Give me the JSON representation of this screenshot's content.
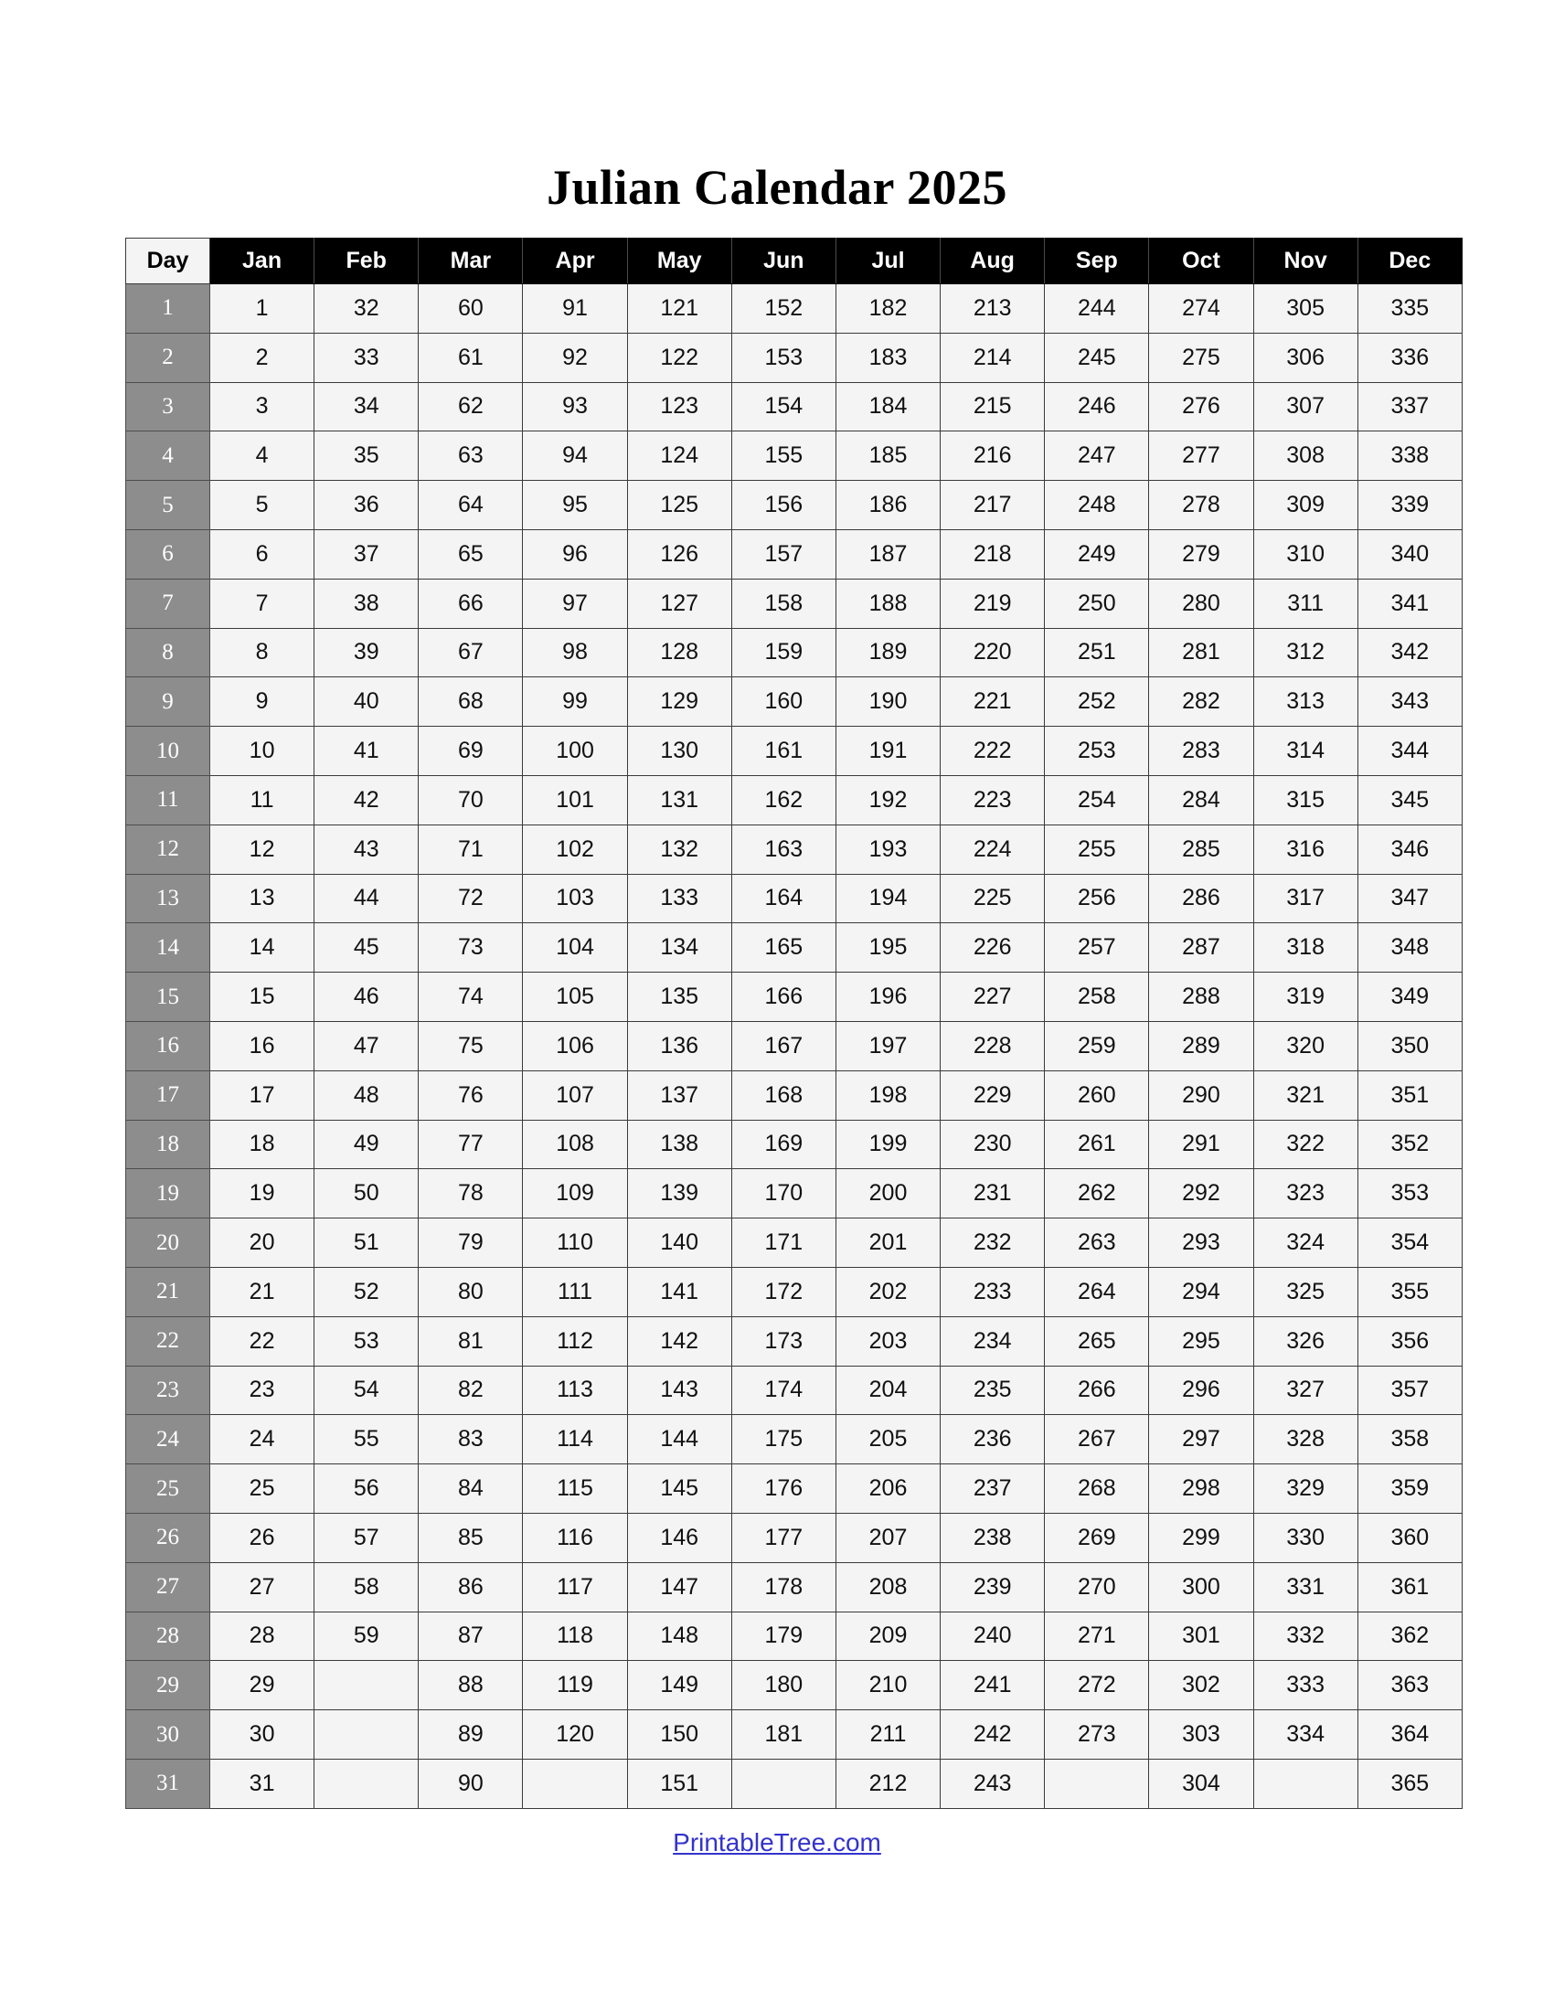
{
  "document": {
    "title": "Julian Calendar 2025",
    "year": "2025"
  },
  "footer": {
    "link_label": "PrintableTree.com",
    "link_color": "#3333cc"
  },
  "colors": {
    "header_background": "#000000",
    "header_text": "#ffffff",
    "day_header_background": "#f4f4f4",
    "day_header_text": "#000000",
    "day_column_background": "#8d8d8d",
    "day_column_text": "#ffffff",
    "cell_background": "#f4f4f4",
    "cell_text": "#111111",
    "border": "#3a3a3a",
    "page_background": "#ffffff"
  },
  "table": {
    "headers": [
      "Day",
      "Jan",
      "Feb",
      "Mar",
      "Apr",
      "May",
      "Jun",
      "Jul",
      "Aug",
      "Sep",
      "Oct",
      "Nov",
      "Dec"
    ],
    "day_header": "Day",
    "month_headers": [
      "Jan",
      "Feb",
      "Mar",
      "Apr",
      "May",
      "Jun",
      "Jul",
      "Aug",
      "Sep",
      "Oct",
      "Nov",
      "Dec"
    ],
    "rows": [
      {
        "day": "1",
        "values": [
          "1",
          "32",
          "60",
          "91",
          "121",
          "152",
          "182",
          "213",
          "244",
          "274",
          "305",
          "335"
        ]
      },
      {
        "day": "2",
        "values": [
          "2",
          "33",
          "61",
          "92",
          "122",
          "153",
          "183",
          "214",
          "245",
          "275",
          "306",
          "336"
        ]
      },
      {
        "day": "3",
        "values": [
          "3",
          "34",
          "62",
          "93",
          "123",
          "154",
          "184",
          "215",
          "246",
          "276",
          "307",
          "337"
        ]
      },
      {
        "day": "4",
        "values": [
          "4",
          "35",
          "63",
          "94",
          "124",
          "155",
          "185",
          "216",
          "247",
          "277",
          "308",
          "338"
        ]
      },
      {
        "day": "5",
        "values": [
          "5",
          "36",
          "64",
          "95",
          "125",
          "156",
          "186",
          "217",
          "248",
          "278",
          "309",
          "339"
        ]
      },
      {
        "day": "6",
        "values": [
          "6",
          "37",
          "65",
          "96",
          "126",
          "157",
          "187",
          "218",
          "249",
          "279",
          "310",
          "340"
        ]
      },
      {
        "day": "7",
        "values": [
          "7",
          "38",
          "66",
          "97",
          "127",
          "158",
          "188",
          "219",
          "250",
          "280",
          "311",
          "341"
        ]
      },
      {
        "day": "8",
        "values": [
          "8",
          "39",
          "67",
          "98",
          "128",
          "159",
          "189",
          "220",
          "251",
          "281",
          "312",
          "342"
        ]
      },
      {
        "day": "9",
        "values": [
          "9",
          "40",
          "68",
          "99",
          "129",
          "160",
          "190",
          "221",
          "252",
          "282",
          "313",
          "343"
        ]
      },
      {
        "day": "10",
        "values": [
          "10",
          "41",
          "69",
          "100",
          "130",
          "161",
          "191",
          "222",
          "253",
          "283",
          "314",
          "344"
        ]
      },
      {
        "day": "11",
        "values": [
          "11",
          "42",
          "70",
          "101",
          "131",
          "162",
          "192",
          "223",
          "254",
          "284",
          "315",
          "345"
        ]
      },
      {
        "day": "12",
        "values": [
          "12",
          "43",
          "71",
          "102",
          "132",
          "163",
          "193",
          "224",
          "255",
          "285",
          "316",
          "346"
        ]
      },
      {
        "day": "13",
        "values": [
          "13",
          "44",
          "72",
          "103",
          "133",
          "164",
          "194",
          "225",
          "256",
          "286",
          "317",
          "347"
        ]
      },
      {
        "day": "14",
        "values": [
          "14",
          "45",
          "73",
          "104",
          "134",
          "165",
          "195",
          "226",
          "257",
          "287",
          "318",
          "348"
        ]
      },
      {
        "day": "15",
        "values": [
          "15",
          "46",
          "74",
          "105",
          "135",
          "166",
          "196",
          "227",
          "258",
          "288",
          "319",
          "349"
        ]
      },
      {
        "day": "16",
        "values": [
          "16",
          "47",
          "75",
          "106",
          "136",
          "167",
          "197",
          "228",
          "259",
          "289",
          "320",
          "350"
        ]
      },
      {
        "day": "17",
        "values": [
          "17",
          "48",
          "76",
          "107",
          "137",
          "168",
          "198",
          "229",
          "260",
          "290",
          "321",
          "351"
        ]
      },
      {
        "day": "18",
        "values": [
          "18",
          "49",
          "77",
          "108",
          "138",
          "169",
          "199",
          "230",
          "261",
          "291",
          "322",
          "352"
        ]
      },
      {
        "day": "19",
        "values": [
          "19",
          "50",
          "78",
          "109",
          "139",
          "170",
          "200",
          "231",
          "262",
          "292",
          "323",
          "353"
        ]
      },
      {
        "day": "20",
        "values": [
          "20",
          "51",
          "79",
          "110",
          "140",
          "171",
          "201",
          "232",
          "263",
          "293",
          "324",
          "354"
        ]
      },
      {
        "day": "21",
        "values": [
          "21",
          "52",
          "80",
          "111",
          "141",
          "172",
          "202",
          "233",
          "264",
          "294",
          "325",
          "355"
        ]
      },
      {
        "day": "22",
        "values": [
          "22",
          "53",
          "81",
          "112",
          "142",
          "173",
          "203",
          "234",
          "265",
          "295",
          "326",
          "356"
        ]
      },
      {
        "day": "23",
        "values": [
          "23",
          "54",
          "82",
          "113",
          "143",
          "174",
          "204",
          "235",
          "266",
          "296",
          "327",
          "357"
        ]
      },
      {
        "day": "24",
        "values": [
          "24",
          "55",
          "83",
          "114",
          "144",
          "175",
          "205",
          "236",
          "267",
          "297",
          "328",
          "358"
        ]
      },
      {
        "day": "25",
        "values": [
          "25",
          "56",
          "84",
          "115",
          "145",
          "176",
          "206",
          "237",
          "268",
          "298",
          "329",
          "359"
        ]
      },
      {
        "day": "26",
        "values": [
          "26",
          "57",
          "85",
          "116",
          "146",
          "177",
          "207",
          "238",
          "269",
          "299",
          "330",
          "360"
        ]
      },
      {
        "day": "27",
        "values": [
          "27",
          "58",
          "86",
          "117",
          "147",
          "178",
          "208",
          "239",
          "270",
          "300",
          "331",
          "361"
        ]
      },
      {
        "day": "28",
        "values": [
          "28",
          "59",
          "87",
          "118",
          "148",
          "179",
          "209",
          "240",
          "271",
          "301",
          "332",
          "362"
        ]
      },
      {
        "day": "29",
        "values": [
          "29",
          "",
          "88",
          "119",
          "149",
          "180",
          "210",
          "241",
          "272",
          "302",
          "333",
          "363"
        ]
      },
      {
        "day": "30",
        "values": [
          "30",
          "",
          "89",
          "120",
          "150",
          "181",
          "211",
          "242",
          "273",
          "303",
          "334",
          "364"
        ]
      },
      {
        "day": "31",
        "values": [
          "31",
          "",
          "90",
          "",
          "151",
          "",
          "212",
          "243",
          "",
          "304",
          "",
          "365"
        ]
      }
    ]
  }
}
